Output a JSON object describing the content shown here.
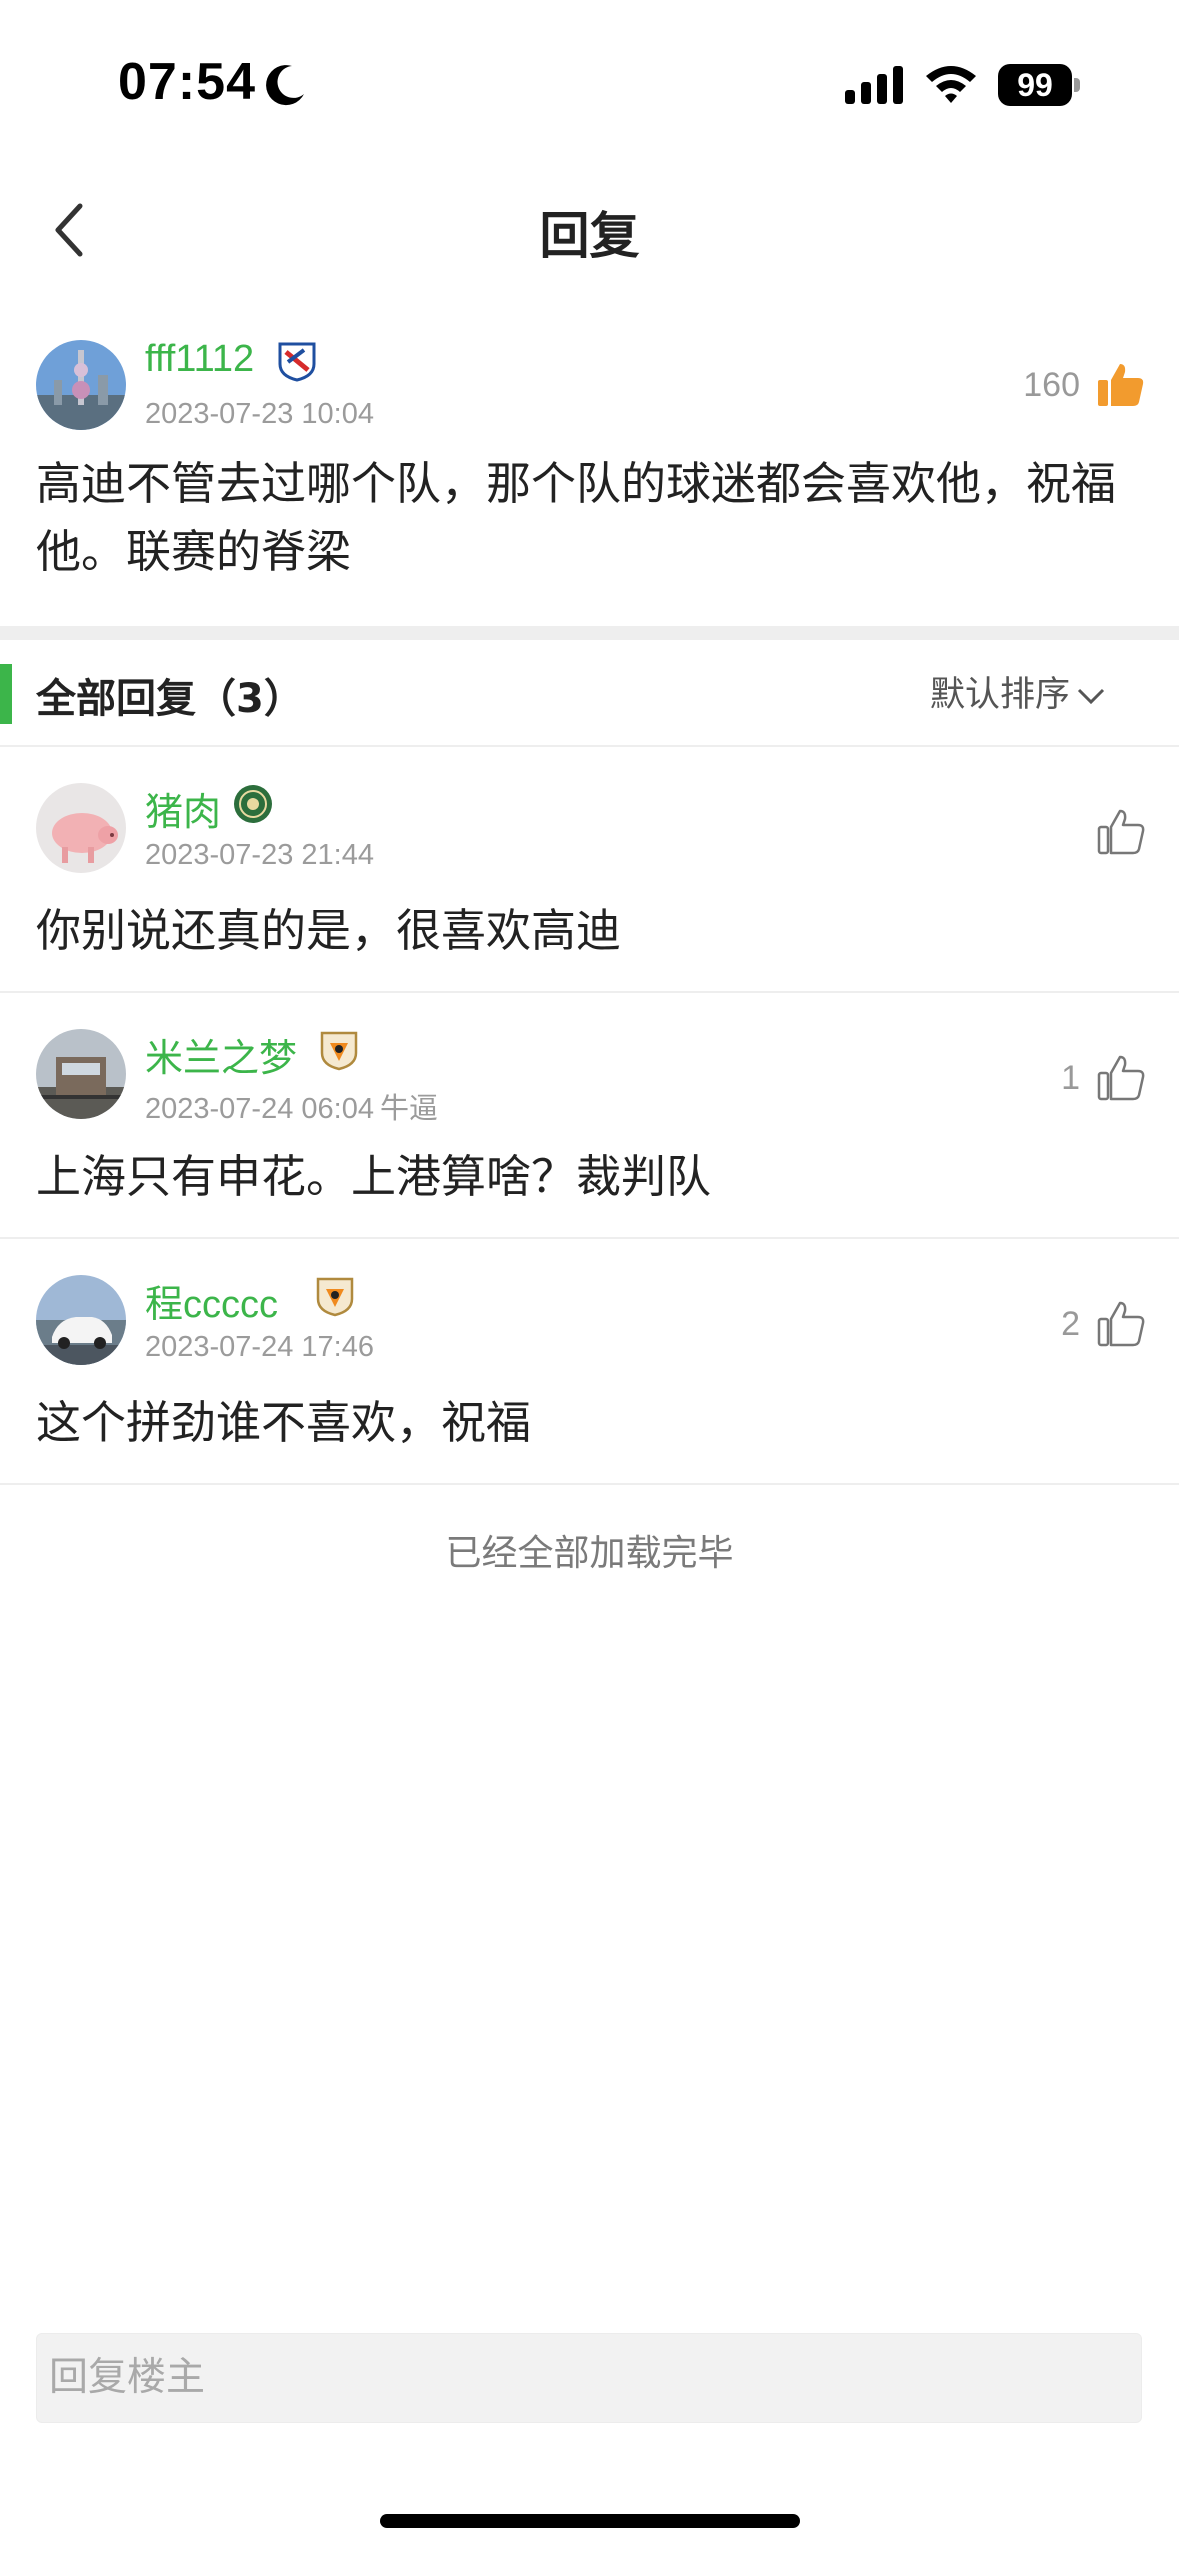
{
  "status_bar": {
    "time": "07:54",
    "battery": "99"
  },
  "nav": {
    "title": "回复"
  },
  "post": {
    "username": "fff1112",
    "timestamp": "2023-07-23 10:04",
    "likes": "160",
    "content": "高迪不管去过哪个队，那个队的球迷都会喜欢他，祝福他。联赛的脊梁"
  },
  "section": {
    "title": "全部回复（3）",
    "sort_label": "默认排序"
  },
  "replies": [
    {
      "username": "猪肉",
      "timestamp": "2023-07-23 21:44",
      "tag": "",
      "likes": "",
      "content": "你别说还真的是，很喜欢高迪"
    },
    {
      "username": "米兰之梦",
      "timestamp": "2023-07-24 06:04",
      "tag": "牛逼",
      "likes": "1",
      "content": "上海只有申花。上港算啥？裁判队"
    },
    {
      "username": "程ccccc",
      "timestamp": "2023-07-24 17:46",
      "tag": "",
      "likes": "2",
      "content": "这个拼劲谁不喜欢，祝福"
    }
  ],
  "footer": {
    "end_text": "已经全部加载完毕",
    "input_placeholder": "回复楼主"
  },
  "colors": {
    "accent_green": "#3cb54a",
    "like_orange": "#f29b2e",
    "meta_gray": "#9b9b9b"
  }
}
